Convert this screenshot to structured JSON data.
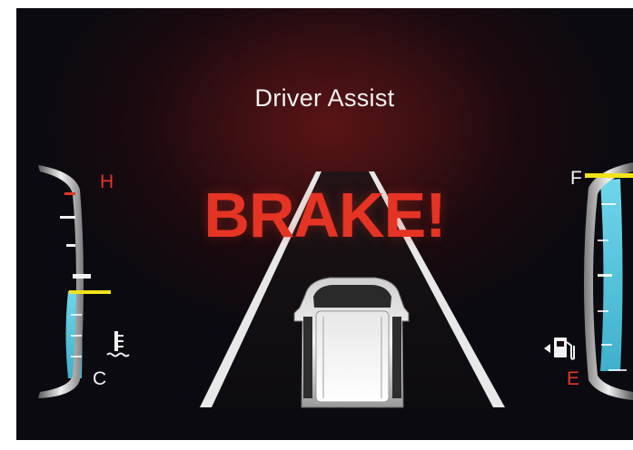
{
  "screen": {
    "title": "Driver Assist",
    "alert_text": "BRAKE!"
  },
  "temperature_gauge": {
    "high_label": "H",
    "low_label": "C",
    "icon": "coolant-temperature-icon",
    "level": 0.42,
    "colors": {
      "fill": "#4fc3d9",
      "indicator": "#f2e21a",
      "high": "#e53423"
    }
  },
  "fuel_gauge": {
    "full_label": "F",
    "empty_label": "E",
    "icon": "fuel-pump-icon",
    "level": 0.97,
    "colors": {
      "fill": "#4fc3d9",
      "indicator": "#f2e21a",
      "empty": "#e53423"
    }
  }
}
